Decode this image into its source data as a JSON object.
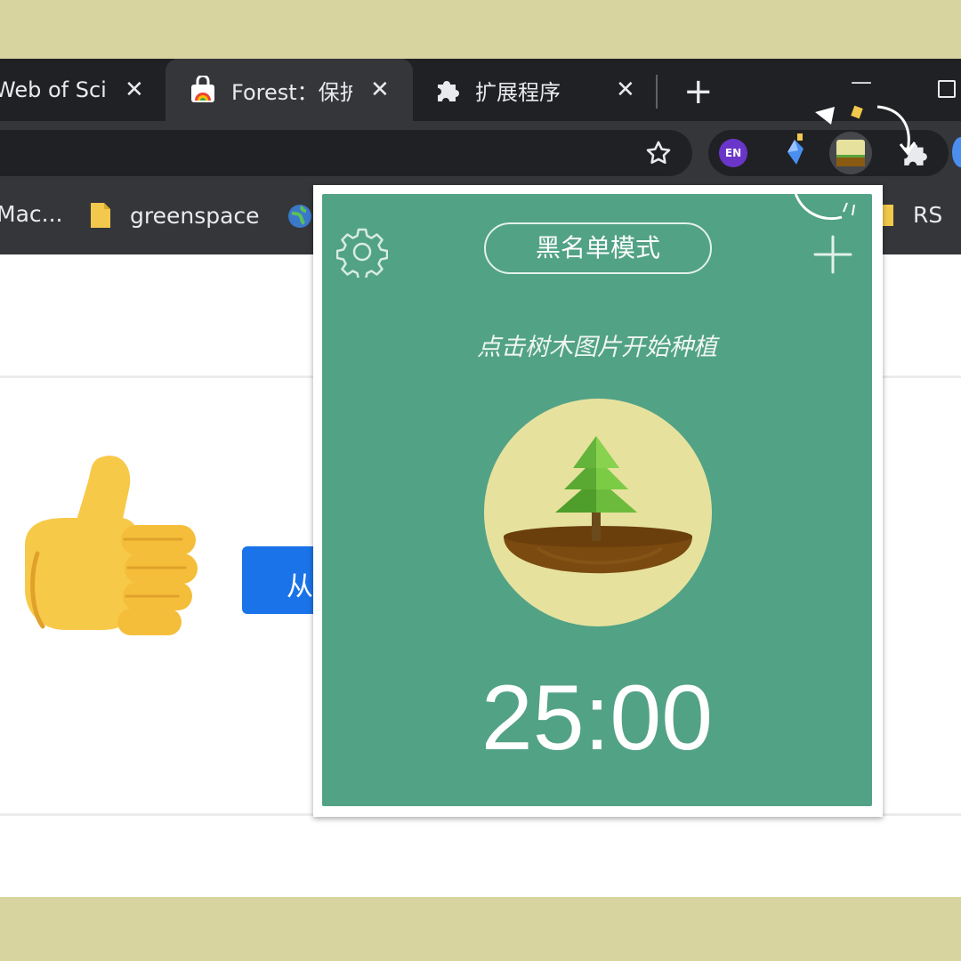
{
  "browser": {
    "tabs": [
      {
        "title": "Web of Scie",
        "close": "✕"
      },
      {
        "title": "Forest：保护",
        "close": "✕"
      },
      {
        "title": "扩展程序",
        "close": "✕"
      }
    ],
    "new_tab": "+",
    "window_minimize": "—",
    "extensions": {
      "en_badge": "EN"
    },
    "bookmarks": [
      {
        "label": "Mac..."
      },
      {
        "label": "greenspace"
      },
      {
        "label": "RS"
      }
    ]
  },
  "page": {
    "primary_button_label": "从"
  },
  "popup": {
    "mode_label": "黑名单模式",
    "hint": "点击树木图片开始种植",
    "timer": "25:00"
  },
  "colors": {
    "background_frame": "#d8d4a0",
    "popup_green": "#52a286",
    "tree_disc": "#e6e29e",
    "primary_blue": "#1a73e8"
  }
}
